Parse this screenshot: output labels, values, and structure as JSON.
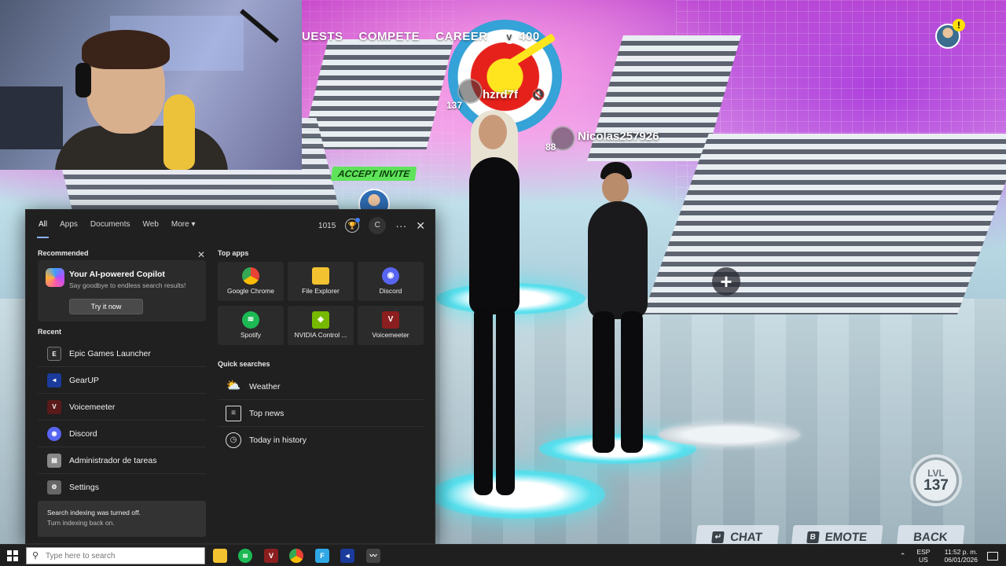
{
  "game": {
    "nav": {
      "quests": "UESTS",
      "compete": "COMPETE",
      "career": "CAREER",
      "vbucks": "400"
    },
    "players": [
      {
        "name": "hzrd7f",
        "level": "137"
      },
      {
        "name": "Nicolas257926",
        "level": "88"
      }
    ],
    "accept_invite": "ACCEPT INVITE",
    "level_badge": {
      "label": "LVL",
      "value": "137"
    },
    "buttons": {
      "chat": "CHAT",
      "emote": "EMOTE",
      "back": "BACK"
    },
    "alert": "!"
  },
  "search_panel": {
    "tabs": [
      "All",
      "Apps",
      "Documents",
      "Web",
      "More"
    ],
    "points": "1015",
    "account_initial": "C",
    "recommended_title": "Recommended",
    "copilot": {
      "title": "Your AI-powered Copilot",
      "subtitle": "Say goodbye to endless search results!",
      "button": "Try it now"
    },
    "recent_title": "Recent",
    "recent": [
      {
        "label": "Epic Games Launcher",
        "icon": "epic-games-icon",
        "color": "#2b2b2b"
      },
      {
        "label": "GearUP",
        "icon": "gearup-icon",
        "color": "#1a3a9c"
      },
      {
        "label": "Voicemeeter",
        "icon": "voicemeeter-icon",
        "color": "#5a1a1a"
      },
      {
        "label": "Discord",
        "icon": "discord-icon",
        "color": "#5865f2"
      },
      {
        "label": "Administrador de tareas",
        "icon": "task-manager-icon",
        "color": "#888888"
      },
      {
        "label": "Settings",
        "icon": "gear-icon",
        "color": "#666666"
      }
    ],
    "indexing": {
      "title": "Search indexing was turned off.",
      "subtitle": "Turn indexing back on."
    },
    "top_apps_title": "Top apps",
    "top_apps": [
      {
        "label": "Google Chrome",
        "icon": "chrome-icon",
        "color": "#e94235"
      },
      {
        "label": "File Explorer",
        "icon": "folder-icon",
        "color": "#f2c230"
      },
      {
        "label": "Discord",
        "icon": "discord-icon",
        "color": "#5865f2"
      },
      {
        "label": "Spotify",
        "icon": "spotify-icon",
        "color": "#1db954"
      },
      {
        "label": "NVIDIA Control ...",
        "icon": "nvidia-icon",
        "color": "#76b900"
      },
      {
        "label": "Voicemeeter",
        "icon": "voicemeeter-icon",
        "color": "#8b1e1e"
      }
    ],
    "quick_searches_title": "Quick searches",
    "quick_searches": [
      {
        "label": "Weather",
        "icon": "weather-icon"
      },
      {
        "label": "Top news",
        "icon": "news-icon"
      },
      {
        "label": "Today in history",
        "icon": "clock-icon"
      }
    ]
  },
  "taskbar": {
    "search_placeholder": "Type here to search",
    "apps": [
      {
        "name": "file-explorer-icon",
        "color": "#f2c230"
      },
      {
        "name": "spotify-icon",
        "color": "#1db954"
      },
      {
        "name": "voicemeeter-icon",
        "color": "#8b1e1e"
      },
      {
        "name": "chrome-icon",
        "color": "#e94235"
      },
      {
        "name": "fortnite-icon",
        "color": "#2fa8e6"
      },
      {
        "name": "gearup-icon",
        "color": "#1a3a9c"
      },
      {
        "name": "pen-icon",
        "color": "#444444"
      }
    ],
    "lang_top": "ESP",
    "lang_bottom": "US",
    "time": "11:52 p. m.",
    "date": "06/01/2026"
  }
}
